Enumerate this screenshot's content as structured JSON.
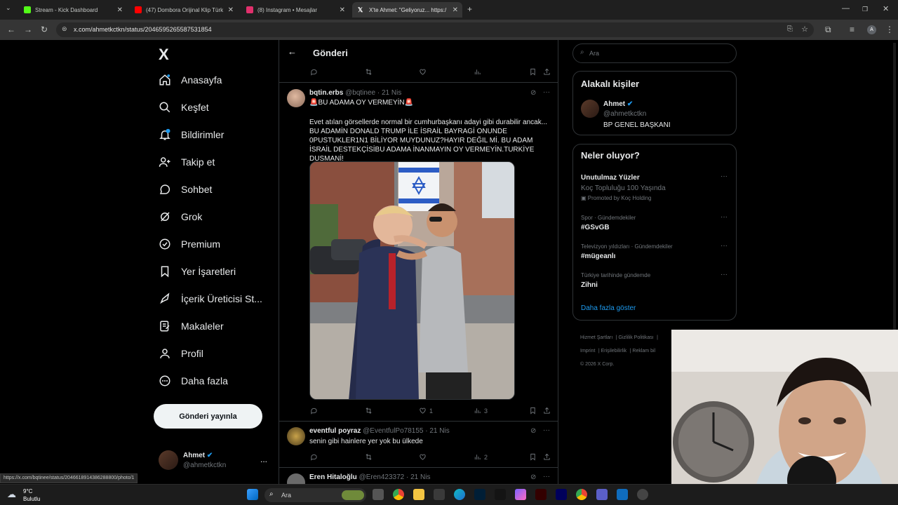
{
  "browser": {
    "tabs": [
      {
        "title": "Stream - Kick Dashboard",
        "icon": "kick-icon",
        "color": "#53fc18"
      },
      {
        "title": "(47) Dombora Orijinal Klip Türk",
        "icon": "youtube-icon",
        "color": "#ff0000"
      },
      {
        "title": "(8) Instagram • Mesajlar",
        "icon": "instagram-icon",
        "color": "#e1306c"
      },
      {
        "title": "X'te Ahmet: \"Geliyoruz... https:/",
        "icon": "x-icon",
        "color": "#ffffff"
      }
    ],
    "url": "x.com/ahmetkctkn/status/2046595265587531854",
    "status_url": "https://x.com/bqtinee/status/2046618914386288800/photo/1"
  },
  "left_nav": {
    "logo": "X",
    "items": [
      {
        "label": "Anasayfa",
        "icon": "home-icon"
      },
      {
        "label": "Keşfet",
        "icon": "search-icon"
      },
      {
        "label": "Bildirimler",
        "icon": "bell-icon",
        "badge": "1"
      },
      {
        "label": "Takip et",
        "icon": "add-user-icon"
      },
      {
        "label": "Sohbet",
        "icon": "chat-icon"
      },
      {
        "label": "Grok",
        "icon": "grok-icon"
      },
      {
        "label": "Premium",
        "icon": "premium-icon"
      },
      {
        "label": "Yer İşaretleri",
        "icon": "bookmark-icon"
      },
      {
        "label": "İçerik Üreticisi St...",
        "icon": "rocket-icon"
      },
      {
        "label": "Makaleler",
        "icon": "article-icon"
      },
      {
        "label": "Profil",
        "icon": "profile-icon"
      },
      {
        "label": "Daha fazla",
        "icon": "more-icon"
      }
    ],
    "post_button": "Gönderi yayınla",
    "account": {
      "name": "Ahmet",
      "handle": "@ahmetkctkn",
      "more": "..."
    }
  },
  "column": {
    "title": "Gönderi",
    "tweets": [
      {
        "name": "bqtin.erbs",
        "handle": "@bqtinee",
        "time": "· 21 Nis",
        "headline": "🚨BU ADAMA OY VERMEYİN🚨",
        "body": "Evet atılan görsellerde normal bir cumhurbaşkanı adayi gibi durabilir ancak... BU ADAMİN DONALD TRUMP İLE İSRAİL BAYRAGİ ONUNDE 0PUSTUKLER1N1 BİLİYOR MUYDUNUZ?HAYIR DEĞIL Mİ. BU ADAM İSRAİL DESTEKÇİSİBU ADAMA İNANMAYIN OY VERMEYİN.TURKİYE DUSMANİ!",
        "likes": "1",
        "views": "3"
      },
      {
        "name": "eventful poyraz",
        "handle": "@EventfulPo78155",
        "time": "· 21 Nis",
        "body": "senin gibi hainlere yer yok bu ülkede",
        "views": "2"
      },
      {
        "name": "Eren Hitaloğlu",
        "handle": "@Eren423372",
        "time": "· 21 Nis"
      }
    ]
  },
  "right": {
    "search_placeholder": "Ara",
    "related": {
      "title": "Alakalı kişiler",
      "name": "Ahmet",
      "handle": "@ahmetkctkn",
      "bio": "BP GENEL BAŞKANI"
    },
    "trends": {
      "title": "Neler oluyor?",
      "promo": {
        "name": "Unutulmaz Yüzler",
        "sub": "Koç Topluluğu 100 Yaşında",
        "promoted": "Promoted by Koç Holding"
      },
      "items": [
        {
          "cat": "Spor · Gündemdekiler",
          "name": "#GSvGB"
        },
        {
          "cat": "Televizyon yıldızları · Gündemdekiler",
          "name": "#mügeanlı"
        },
        {
          "cat": "Türkiye tarihinde gündemde",
          "name": "Zihni"
        }
      ],
      "show_more": "Daha fazla göster"
    },
    "footer": [
      "Hizmet Şartları",
      "Gizlilik Politikası",
      "Imprint",
      "Erişilebilirlik",
      "Reklam bil"
    ],
    "copyright": "© 2026 X Corp."
  },
  "taskbar": {
    "weather_temp": "9°C",
    "weather_desc": "Bulutlu",
    "search": "Ara"
  }
}
